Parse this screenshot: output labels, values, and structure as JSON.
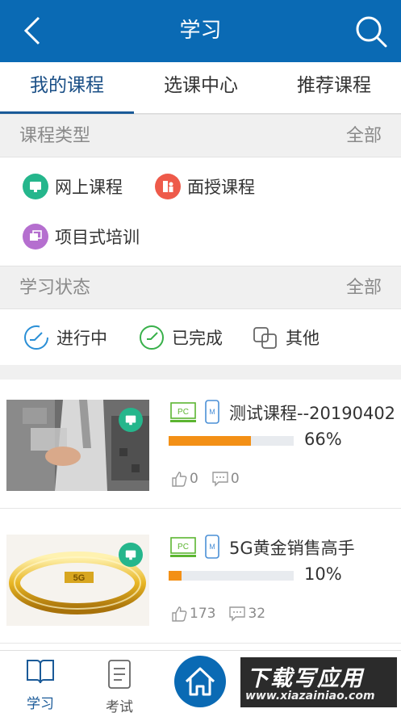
{
  "header": {
    "title": "学习",
    "back_icon": "chevron-left-icon",
    "search_icon": "search-icon"
  },
  "tabs": [
    {
      "label": "我的课程",
      "active": true
    },
    {
      "label": "选课中心",
      "active": false
    },
    {
      "label": "推荐课程",
      "active": false
    }
  ],
  "course_type": {
    "label": "课程类型",
    "all": "全部",
    "items": [
      {
        "label": "网上课程",
        "icon": "monitor-icon",
        "color": "#25b68c"
      },
      {
        "label": "面授课程",
        "icon": "classroom-icon",
        "color": "#ee5a4a"
      },
      {
        "label": "项目式培训",
        "icon": "project-icon",
        "color": "#b56fcf"
      }
    ]
  },
  "study_status": {
    "label": "学习状态",
    "all": "全部",
    "items": [
      {
        "label": "进行中",
        "icon": "in-progress-icon",
        "color": "#2a8fd6"
      },
      {
        "label": "已完成",
        "icon": "completed-icon",
        "color": "#38b04a"
      },
      {
        "label": "其他",
        "icon": "other-icon",
        "color": "#666666"
      }
    ]
  },
  "courses": [
    {
      "name": "测试课程--20190402",
      "progress": 66,
      "progress_text": "66%",
      "likes": "0",
      "comments": "0",
      "pc_tag": "PC",
      "m_tag": "M"
    },
    {
      "name": "5G黄金销售高手",
      "progress": 10,
      "progress_text": "10%",
      "likes": "173",
      "comments": "32",
      "pc_tag": "PC",
      "m_tag": "M"
    }
  ],
  "bottom_nav": {
    "study": "学习",
    "exam": "考试"
  },
  "watermark": {
    "line1": "下载写应用",
    "line2": "www.xiazainiao.com"
  },
  "colors": {
    "primary": "#0a6ab4",
    "progress": "#f39016",
    "online_green": "#25b68c"
  }
}
